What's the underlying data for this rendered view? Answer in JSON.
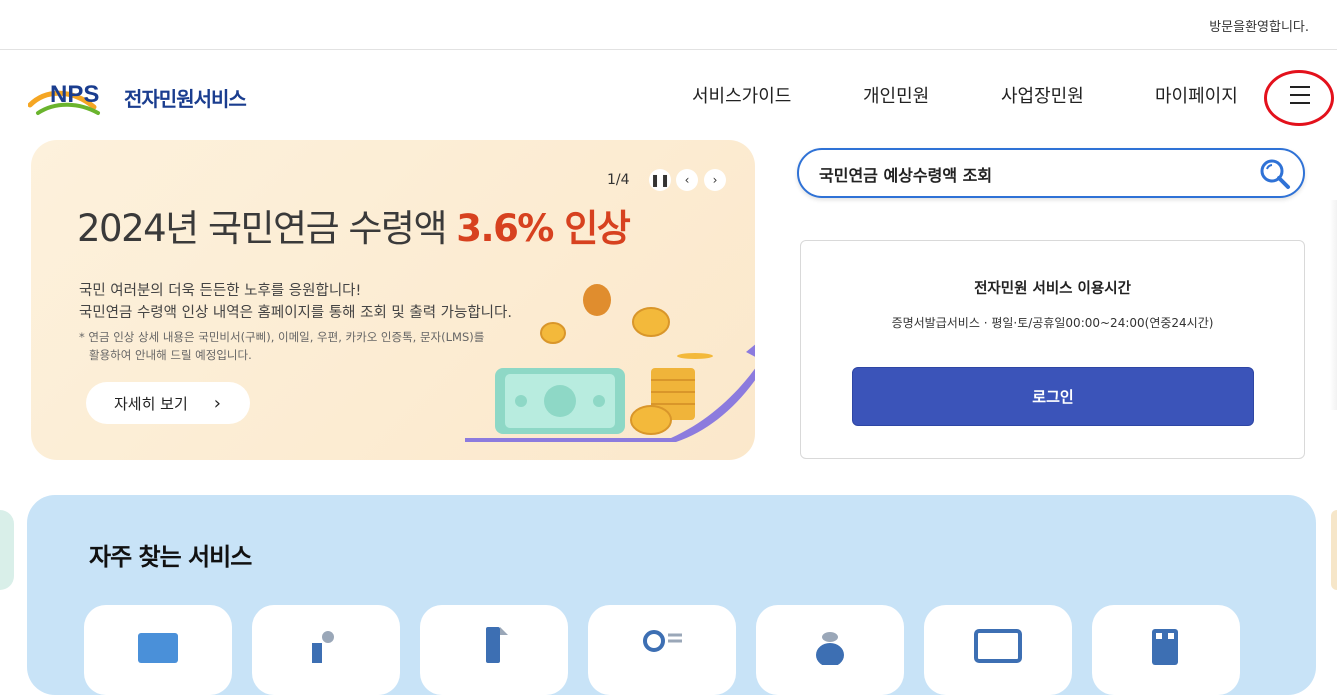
{
  "topbar": {
    "welcome": "방문을환영합니다."
  },
  "header": {
    "logo_text": "NPS",
    "brand": "전자민원서비스",
    "nav": [
      {
        "label": "서비스가이드"
      },
      {
        "label": "개인민원"
      },
      {
        "label": "사업장민원"
      },
      {
        "label": "마이페이지"
      }
    ],
    "menu_icon": "hamburger-menu-icon"
  },
  "banner": {
    "pager": "1/4",
    "title_prefix": "2024년 국민연금 수령액 ",
    "title_highlight": "3.6% 인상",
    "desc_line1": "국민 여러분의 더욱 든든한 노후를 응원합니다!",
    "desc_line2": "국민연금 수령액 인상 내역은 홈페이지를 통해 조회 및 출력 가능합니다.",
    "note_line1": "* 연금 인상 상세 내용은 국민비서(구삐), 이메일, 우편, 카카오 인증톡, 문자(LMS)를",
    "note_line2": "활용하여 안내해 드릴 예정입니다.",
    "more_label": "자세히 보기",
    "highlight_color": "#d7411f",
    "background_color": "#fbe8cb"
  },
  "search": {
    "value": "국민연금 예상수령액 조회",
    "accent_color": "#2f72d6",
    "icon": "search-icon"
  },
  "service_hours": {
    "title": "전자민원 서비스 이용시간",
    "subtitle": "증명서발급서비스 · 평일·토/공휴일00:00~24:00(연중24시간)",
    "login_label": "로그인",
    "login_color": "#3b54b9"
  },
  "frequent": {
    "title": "자주 찾는 서비스",
    "background_color": "#c8e3f7",
    "cards": [
      {
        "icon": "document-icon"
      },
      {
        "icon": "hand-coin-icon"
      },
      {
        "icon": "file-icon"
      },
      {
        "icon": "person-search-icon"
      },
      {
        "icon": "money-bag-icon"
      },
      {
        "icon": "monitor-icon"
      },
      {
        "icon": "building-icon"
      }
    ]
  }
}
